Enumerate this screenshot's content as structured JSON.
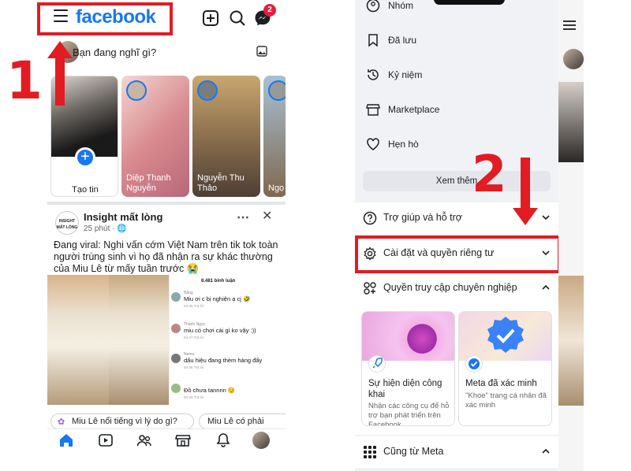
{
  "left": {
    "logo": "facebook",
    "step_number": "1",
    "messenger_badge": "2",
    "composer_placeholder": "Bạn đang nghĩ gì?",
    "stories": [
      {
        "label": "Tạo tin"
      },
      {
        "label": "Diệp Thanh Nguyễn"
      },
      {
        "label": "Nguyễn Thu Thảo"
      },
      {
        "label": "Ngọ"
      }
    ],
    "post": {
      "avatar_text": "INSIGHT MẤT LÒNG",
      "author": "Insight mất lòng",
      "time": "25 phút · ",
      "text": "Đang viral: Nghi vấn cớm Việt Nam trên tik tok toàn người trùng sinh vì họ đã nhận ra sự khác thường của Miu Lê từ mấy tuần trước 😭",
      "comments_title": "8.481 bình luận",
      "comments": [
        {
          "name": "Bằng",
          "text": "Miu ơi c bị nghiện ạ cj 🤣",
          "meta": "04-25   Trả lời"
        },
        {
          "name": "Thành Ngọc",
          "text": "miu có chơi cái gì ko vậy :))",
          "meta": "04-27   Trả lời"
        },
        {
          "name": "Nemo",
          "text": "dấu hiệu đang thèm hàng đấy",
          "meta": "04-26   Trả lời"
        },
        {
          "name": "",
          "text": "Đồ chưa tannnn 😏",
          "meta": "04-26   Trả lời"
        }
      ],
      "chips": [
        "Miu Lê nổi tiếng vì lý do gì?",
        "Miu Lê có phải"
      ]
    }
  },
  "right": {
    "step_number": "2",
    "menu_items": [
      {
        "label": "Nhóm",
        "icon": "group-icon"
      },
      {
        "label": "Đã lưu",
        "icon": "bookmark-icon"
      },
      {
        "label": "Kỷ niệm",
        "icon": "memories-icon"
      },
      {
        "label": "Marketplace",
        "icon": "marketplace-icon"
      },
      {
        "label": "Hẹn hò",
        "icon": "dating-icon"
      }
    ],
    "see_more": "Xem thêm",
    "accordion": [
      {
        "label": "Trợ giúp và hỗ trợ",
        "icon": "help-icon"
      },
      {
        "label": "Cài đặt và quyền riêng tư",
        "icon": "gear-icon"
      },
      {
        "label": "Quyền truy cập chuyên nghiệp",
        "icon": "professional-icon"
      }
    ],
    "cards": [
      {
        "title": "Sự hiện diện công khai",
        "subtitle": "Nhận các công cụ để hỗ trợ bạn phát triển trên Facebook."
      },
      {
        "title": "Meta đã xác minh",
        "subtitle": "\"Khoe\" trang cá nhân đã xác minh"
      }
    ],
    "also_from_meta": "Cũng từ Meta"
  },
  "colors": {
    "brand": "#1877f2",
    "annotation_red": "#e31b23"
  }
}
